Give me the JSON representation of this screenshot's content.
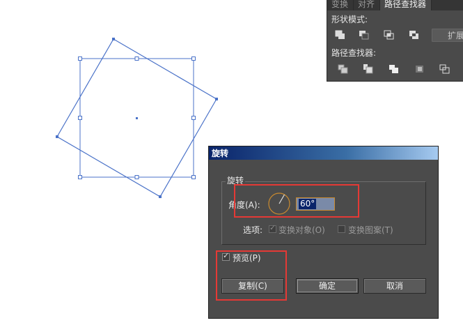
{
  "canvas": {
    "selection_color": "#4a72c8"
  },
  "panel": {
    "tabs": [
      "变换",
      "对齐",
      "路径查找器"
    ],
    "active_tab": "路径查找器",
    "shape_modes_label": "形状模式:",
    "expand_label": "扩展",
    "pathfinders_label": "路径查找器:"
  },
  "dialog": {
    "title": "旋转",
    "group_title": "旋转",
    "angle_label": "角度(A):",
    "angle_value": "60°",
    "options_label": "选项:",
    "transform_objects_label": "变换对象(O)",
    "transform_patterns_label": "变换图案(T)",
    "preview_label": "预览(P)",
    "copy_button": "复制(C)",
    "ok_button": "确定",
    "cancel_button": "取消"
  },
  "annotations": {
    "highlight_color": "#e53935"
  }
}
